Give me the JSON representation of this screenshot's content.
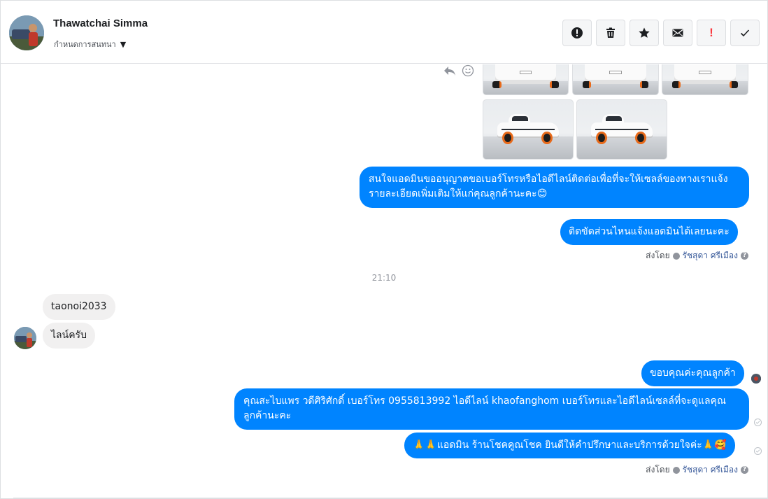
{
  "header": {
    "contact_name": "Thawatchai Simma",
    "assign_label": "กำหนดการสนทนา",
    "toolbar": [
      {
        "name": "spam-button",
        "icon": "alert-circle-icon"
      },
      {
        "name": "delete-button",
        "icon": "trash-icon"
      },
      {
        "name": "star-button",
        "icon": "star-icon"
      },
      {
        "name": "mark-unread-button",
        "icon": "envelope-icon"
      },
      {
        "name": "flag-button",
        "icon": "exclamation-icon",
        "label": "!"
      },
      {
        "name": "mark-done-button",
        "icon": "checkmark-icon"
      }
    ]
  },
  "thread": {
    "messages": [
      {
        "id": "m1",
        "direction": "out",
        "text": "สนใจแอดมินขออนุญาตขอเบอร์โทรหรือไอดีไลน์ติดต่อเพื่อที่จะให้เซลล์ของทางเราแจ้งรายละเอียดเพิ่มเติมให้แก่คุณลูกค้านะคะ😊"
      },
      {
        "id": "m2",
        "direction": "out",
        "text": "ติดขัดส่วนไหนแจ้งแอดมินได้เลยนะคะ"
      },
      {
        "id": "m3",
        "direction": "in",
        "text": "taonoi2033"
      },
      {
        "id": "m4",
        "direction": "in",
        "text": "ไลน์ครับ"
      },
      {
        "id": "m5",
        "direction": "out",
        "text": "ขอบคุณค่ะคุณลูกค้า"
      },
      {
        "id": "m6",
        "direction": "out",
        "text": "คุณสะไบแพร วดีศิริศักดิ์ เบอร์โทร 0955813992  ไอดีไลน์  khaofanghom  เบอร์โทรและไอดีไลน์เซลล์ที่จะดูแลคุณลูกค้านะคะ"
      },
      {
        "id": "m7",
        "direction": "out",
        "text": "🙏🙏แอดมิน ร้านโชคคูณโชค ยินดีให้คำปรึกษาและบริการด้วยใจค่ะ🙏🥰"
      }
    ],
    "sent_by": {
      "prefix": "ส่งโดย",
      "agent": "รัชสุดา ศรีเมือง",
      "help": "?"
    },
    "timestamp": "21:10"
  }
}
